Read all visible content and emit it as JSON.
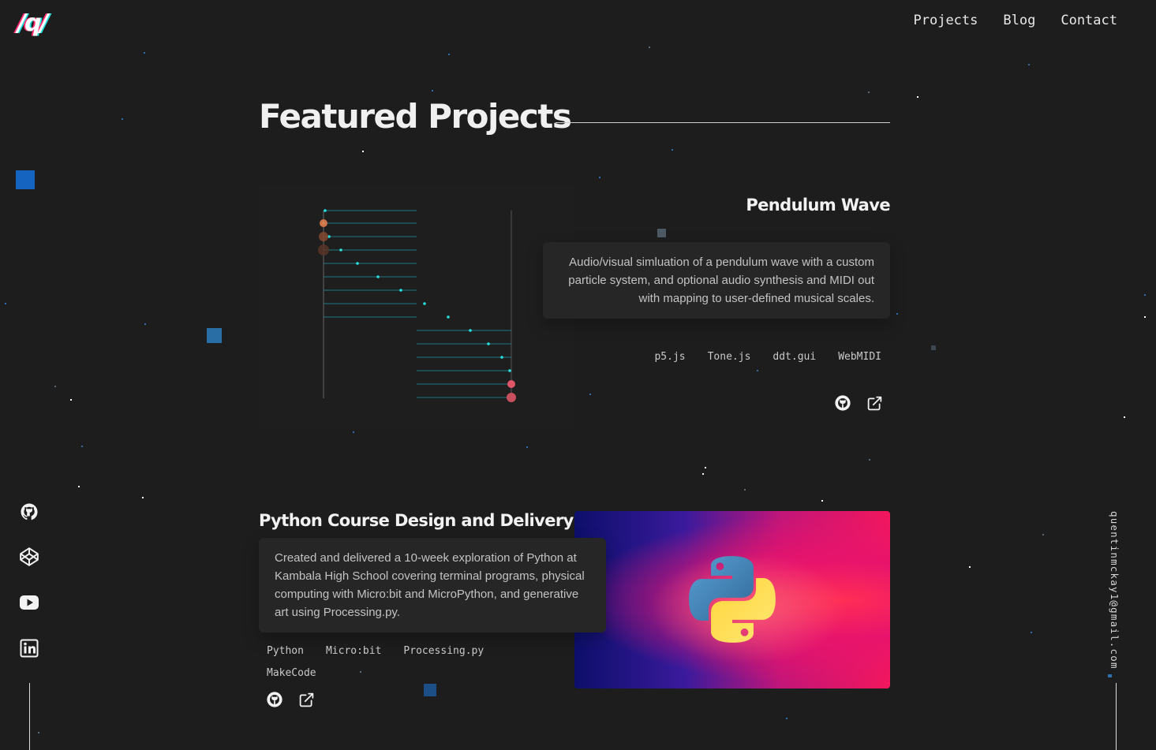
{
  "logo": "/q/",
  "nav": {
    "items": [
      "Projects",
      "Blog",
      "Contact"
    ]
  },
  "social": {
    "github_label": "github-icon",
    "codepen_label": "codepen-icon",
    "youtube_label": "youtube-icon",
    "linkedin_label": "linkedin-icon"
  },
  "email": "quentinmckay1@gmail.com",
  "section": {
    "title": "Featured Projects"
  },
  "projects": [
    {
      "title": "Pendulum Wave",
      "description": "Audio/visual simluation of a pendulum wave with a custom particle system, and optional audio synthesis and MIDI out with mapping to user-defined musical scales.",
      "tags": [
        "p5.js",
        "Tone.js",
        "ddt.gui",
        "WebMIDI"
      ],
      "links": [
        "github-icon",
        "external-link-icon"
      ]
    },
    {
      "title": "Python Course Design and Delivery",
      "description": "Created and delivered a 10-week exploration of Python at Kambala High School covering terminal programs, physical computing with Micro:bit and MicroPython, and generative art using Processing.py.",
      "tags": [
        "Python",
        "Micro:bit",
        "Processing.py",
        "MakeCode"
      ],
      "links": [
        "github-icon",
        "external-link-icon"
      ]
    }
  ],
  "colors": {
    "background": "#1d1d1d",
    "accent_cyan": "#27e0e0",
    "accent_pink": "#ff2d6f",
    "star_blue": "#2f6fb0"
  }
}
